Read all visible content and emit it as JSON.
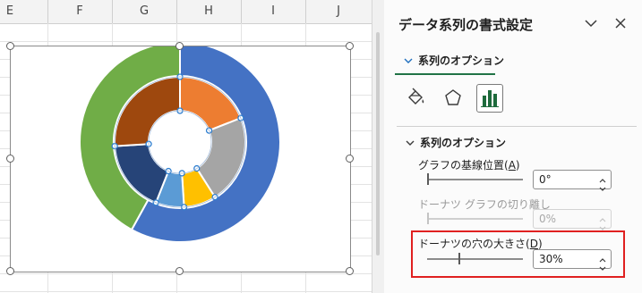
{
  "sheet": {
    "columns": [
      "E",
      "F",
      "G",
      "H",
      "I",
      "J"
    ]
  },
  "chart": {
    "outer_ring": [
      {
        "share": 0.58,
        "color": "#4472C4"
      },
      {
        "share": 0.42,
        "color": "#70AD47"
      }
    ],
    "inner_ring": [
      {
        "share": 0.19,
        "color": "#ED7D31"
      },
      {
        "share": 0.22,
        "color": "#A5A5A5"
      },
      {
        "share": 0.08,
        "color": "#FFC000"
      },
      {
        "share": 0.07,
        "color": "#5B9BD5"
      },
      {
        "share": 0.18,
        "color": "#264478"
      },
      {
        "share": 0.26,
        "color": "#9E480E"
      }
    ]
  },
  "pane": {
    "title": "データ系列の書式設定",
    "options_label": "系列のオプション",
    "section_label": "系列のオプション",
    "accent_color": "#217346",
    "fields": {
      "base_position": {
        "label": "グラフの基線位置",
        "mnemonic": "A",
        "value": "0°",
        "slider_level": 0.0
      },
      "explosion": {
        "label": "ドーナツ グラフの切り離し",
        "value": "0%",
        "slider_level": 0.0
      },
      "hole_size": {
        "label": "ドーナツの穴の大きさ",
        "mnemonic": "D",
        "value": "30%",
        "slider_level": 0.33
      }
    },
    "highlight_color": "#E02020",
    "icons": [
      "dropdown-chevron-icon",
      "close-icon",
      "paint-bucket-icon",
      "pentagon-icon",
      "bar-chart-icon",
      "expand-chevron-icon"
    ]
  }
}
